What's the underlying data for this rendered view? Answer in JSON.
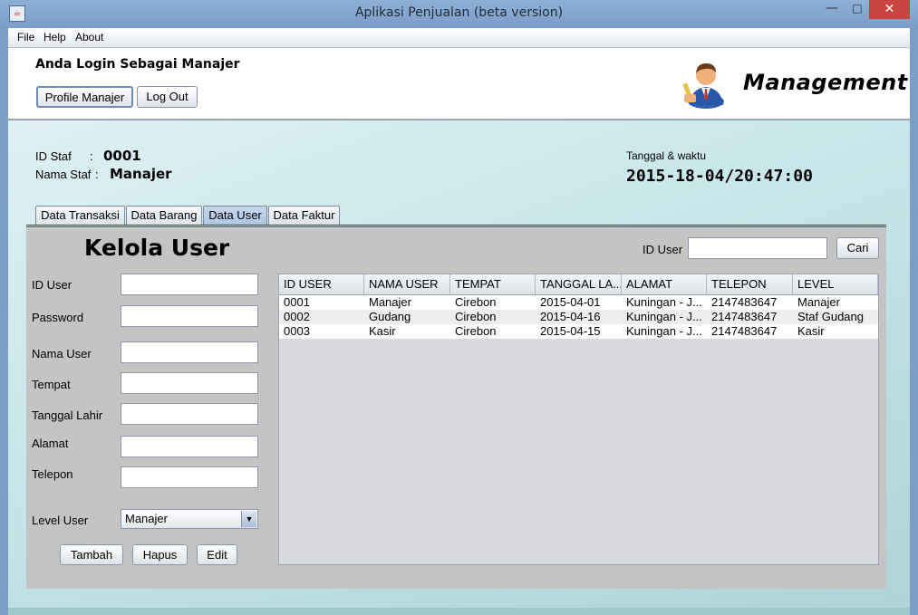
{
  "window": {
    "title": "Aplikasi Penjualan (beta version)",
    "minimize_glyph": "—",
    "maximize_glyph": "□",
    "close_glyph": "✕"
  },
  "menu": [
    "File",
    "Help",
    "About"
  ],
  "header": {
    "login_text": "Anda Login Sebagai Manajer",
    "profile_button": "Profile Manajer",
    "logout_button": "Log Out",
    "brand_icon": "manager-person-icon",
    "brand_label": "Management"
  },
  "staff": {
    "id_label": "ID Staf",
    "id_sep": ":",
    "id_value": "0001",
    "name_label": "Nama Staf",
    "name_sep": ":",
    "name_value": "Manajer"
  },
  "datetime": {
    "label": "Tanggal & waktu",
    "value": "2015-18-04/20:47:00"
  },
  "tabs": [
    "Data Transaksi",
    "Data Barang",
    "Data User",
    "Data Faktur"
  ],
  "active_tab": "Data User",
  "panel": {
    "title": "Kelola User",
    "search_label": "ID User",
    "search_value": "",
    "search_button": "Cari"
  },
  "form": {
    "id_user_label": "ID User",
    "password_label": "Password",
    "nama_user_label": "Nama User",
    "tempat_label": "Tempat",
    "tanggal_lahir_label": "Tanggal Lahir",
    "alamat_label": "Alamat",
    "telepon_label": "Telepon",
    "level_label": "Level User",
    "level_selected": "Manajer",
    "tambah_button": "Tambah",
    "hapus_button": "Hapus",
    "edit_button": "Edit"
  },
  "table": {
    "columns": [
      "ID USER",
      "NAMA USER",
      "TEMPAT",
      "TANGGAL LA...",
      "ALAMAT",
      "TELEPON",
      "LEVEL"
    ],
    "rows": [
      [
        "0001",
        "Manajer",
        "Cirebon",
        "2015-04-01",
        "Kuningan - J...",
        "2147483647",
        "Manajer"
      ],
      [
        "0002",
        "Gudang",
        "Cirebon",
        "2015-04-16",
        "Kuningan - J...",
        "2147483647",
        "Staf Gudang"
      ],
      [
        "0003",
        "Kasir",
        "Cirebon",
        "2015-04-15",
        "Kuningan - J...",
        "2147483647",
        "Kasir"
      ]
    ]
  }
}
